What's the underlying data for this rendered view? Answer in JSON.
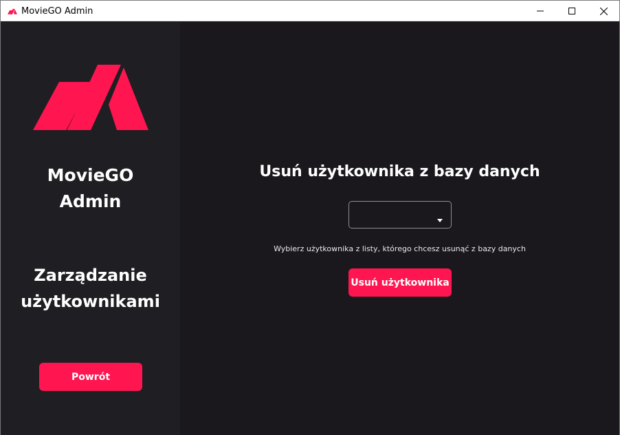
{
  "window": {
    "title": "MovieGO Admin"
  },
  "sidebar": {
    "brand_line1": "MovieGO",
    "brand_line2": "Admin",
    "section_line1": "Zarządzanie",
    "section_line2": "użytkownikami",
    "back_label": "Powrót"
  },
  "main": {
    "heading": "Usuń użytkownika z bazy danych",
    "user_select_value": "",
    "helper_text": "Wybierz użytkownika z listy, którego chcesz usunąć z bazy danych",
    "delete_label": "Usuń użytkownika"
  },
  "colors": {
    "accent": "#ff1550",
    "sidebar_bg": "#1f1e22",
    "main_bg": "#1a181d"
  },
  "icons": {
    "app": "moviego-logo-icon",
    "minimize": "minimize-icon",
    "maximize": "maximize-icon",
    "close": "close-icon",
    "dropdown": "caret-down-icon"
  }
}
